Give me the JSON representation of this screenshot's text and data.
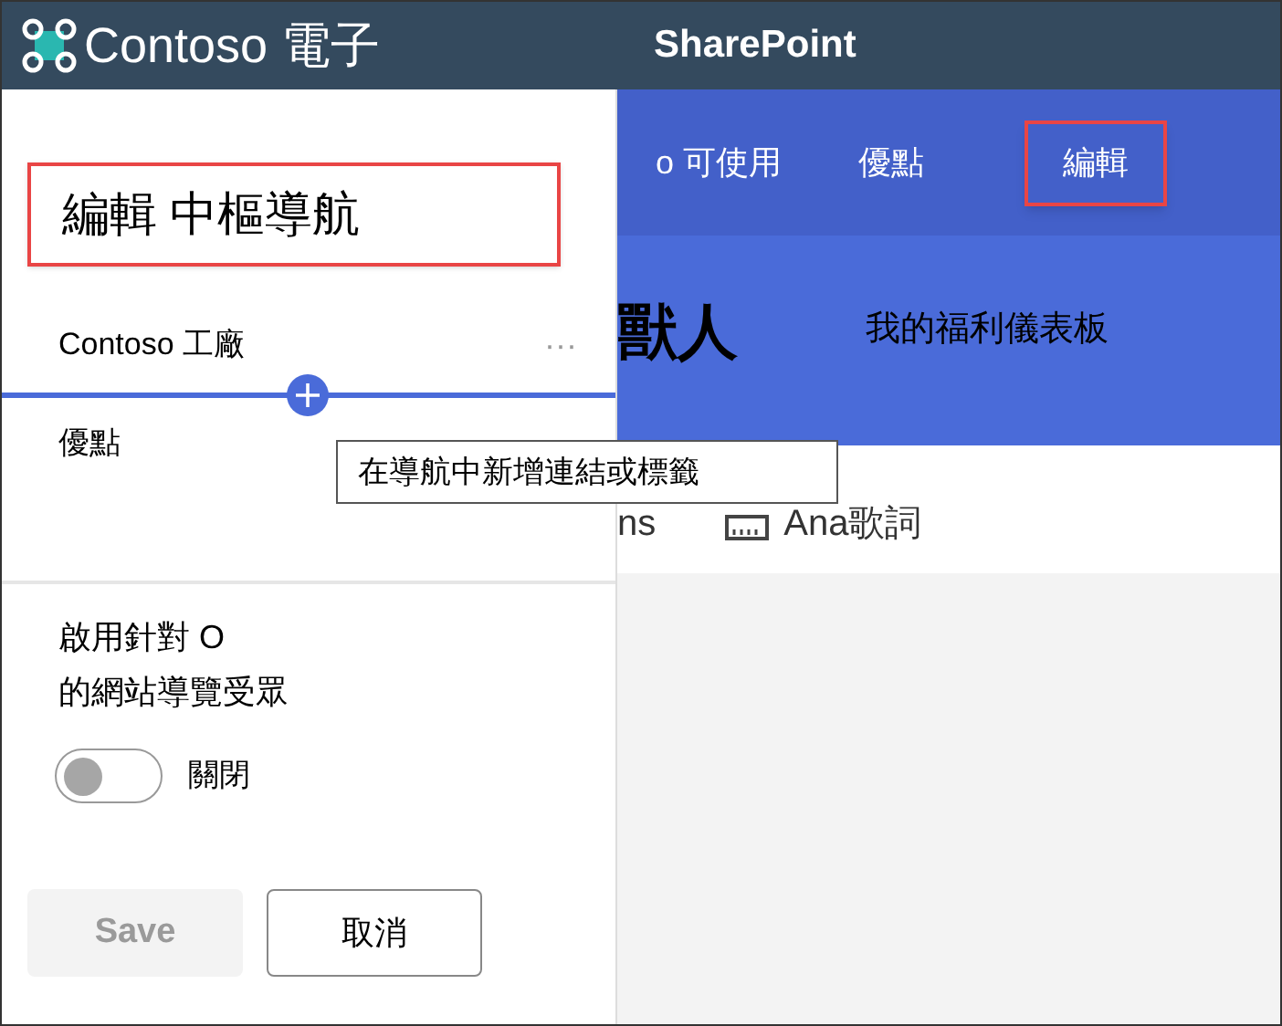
{
  "header": {
    "brand": "Contoso 電子",
    "app": "SharePoint"
  },
  "site_nav": [
    {
      "label": "o 可使用",
      "selected": false
    },
    {
      "label": "優點",
      "selected": false
    },
    {
      "label": "編輯",
      "selected": true
    }
  ],
  "hero": {
    "title": "獸人",
    "link": "我的福利儀表板"
  },
  "quick_links": [
    "ns",
    "Ana歌詞"
  ],
  "panel": {
    "title": "編輯 中樞導航",
    "nav_items": [
      {
        "label": "Contoso 工廠",
        "more": "···"
      },
      {
        "label": "優點"
      }
    ],
    "tooltip": "在導航中新增連結或標籤",
    "audience_label_1": "啟用針對 O",
    "audience_label_2": "的網站導覽受眾",
    "toggle": {
      "on": false,
      "label": "關閉"
    },
    "save": {
      "label": "Save",
      "disabled": true
    },
    "cancel": {
      "label": "取消"
    }
  }
}
